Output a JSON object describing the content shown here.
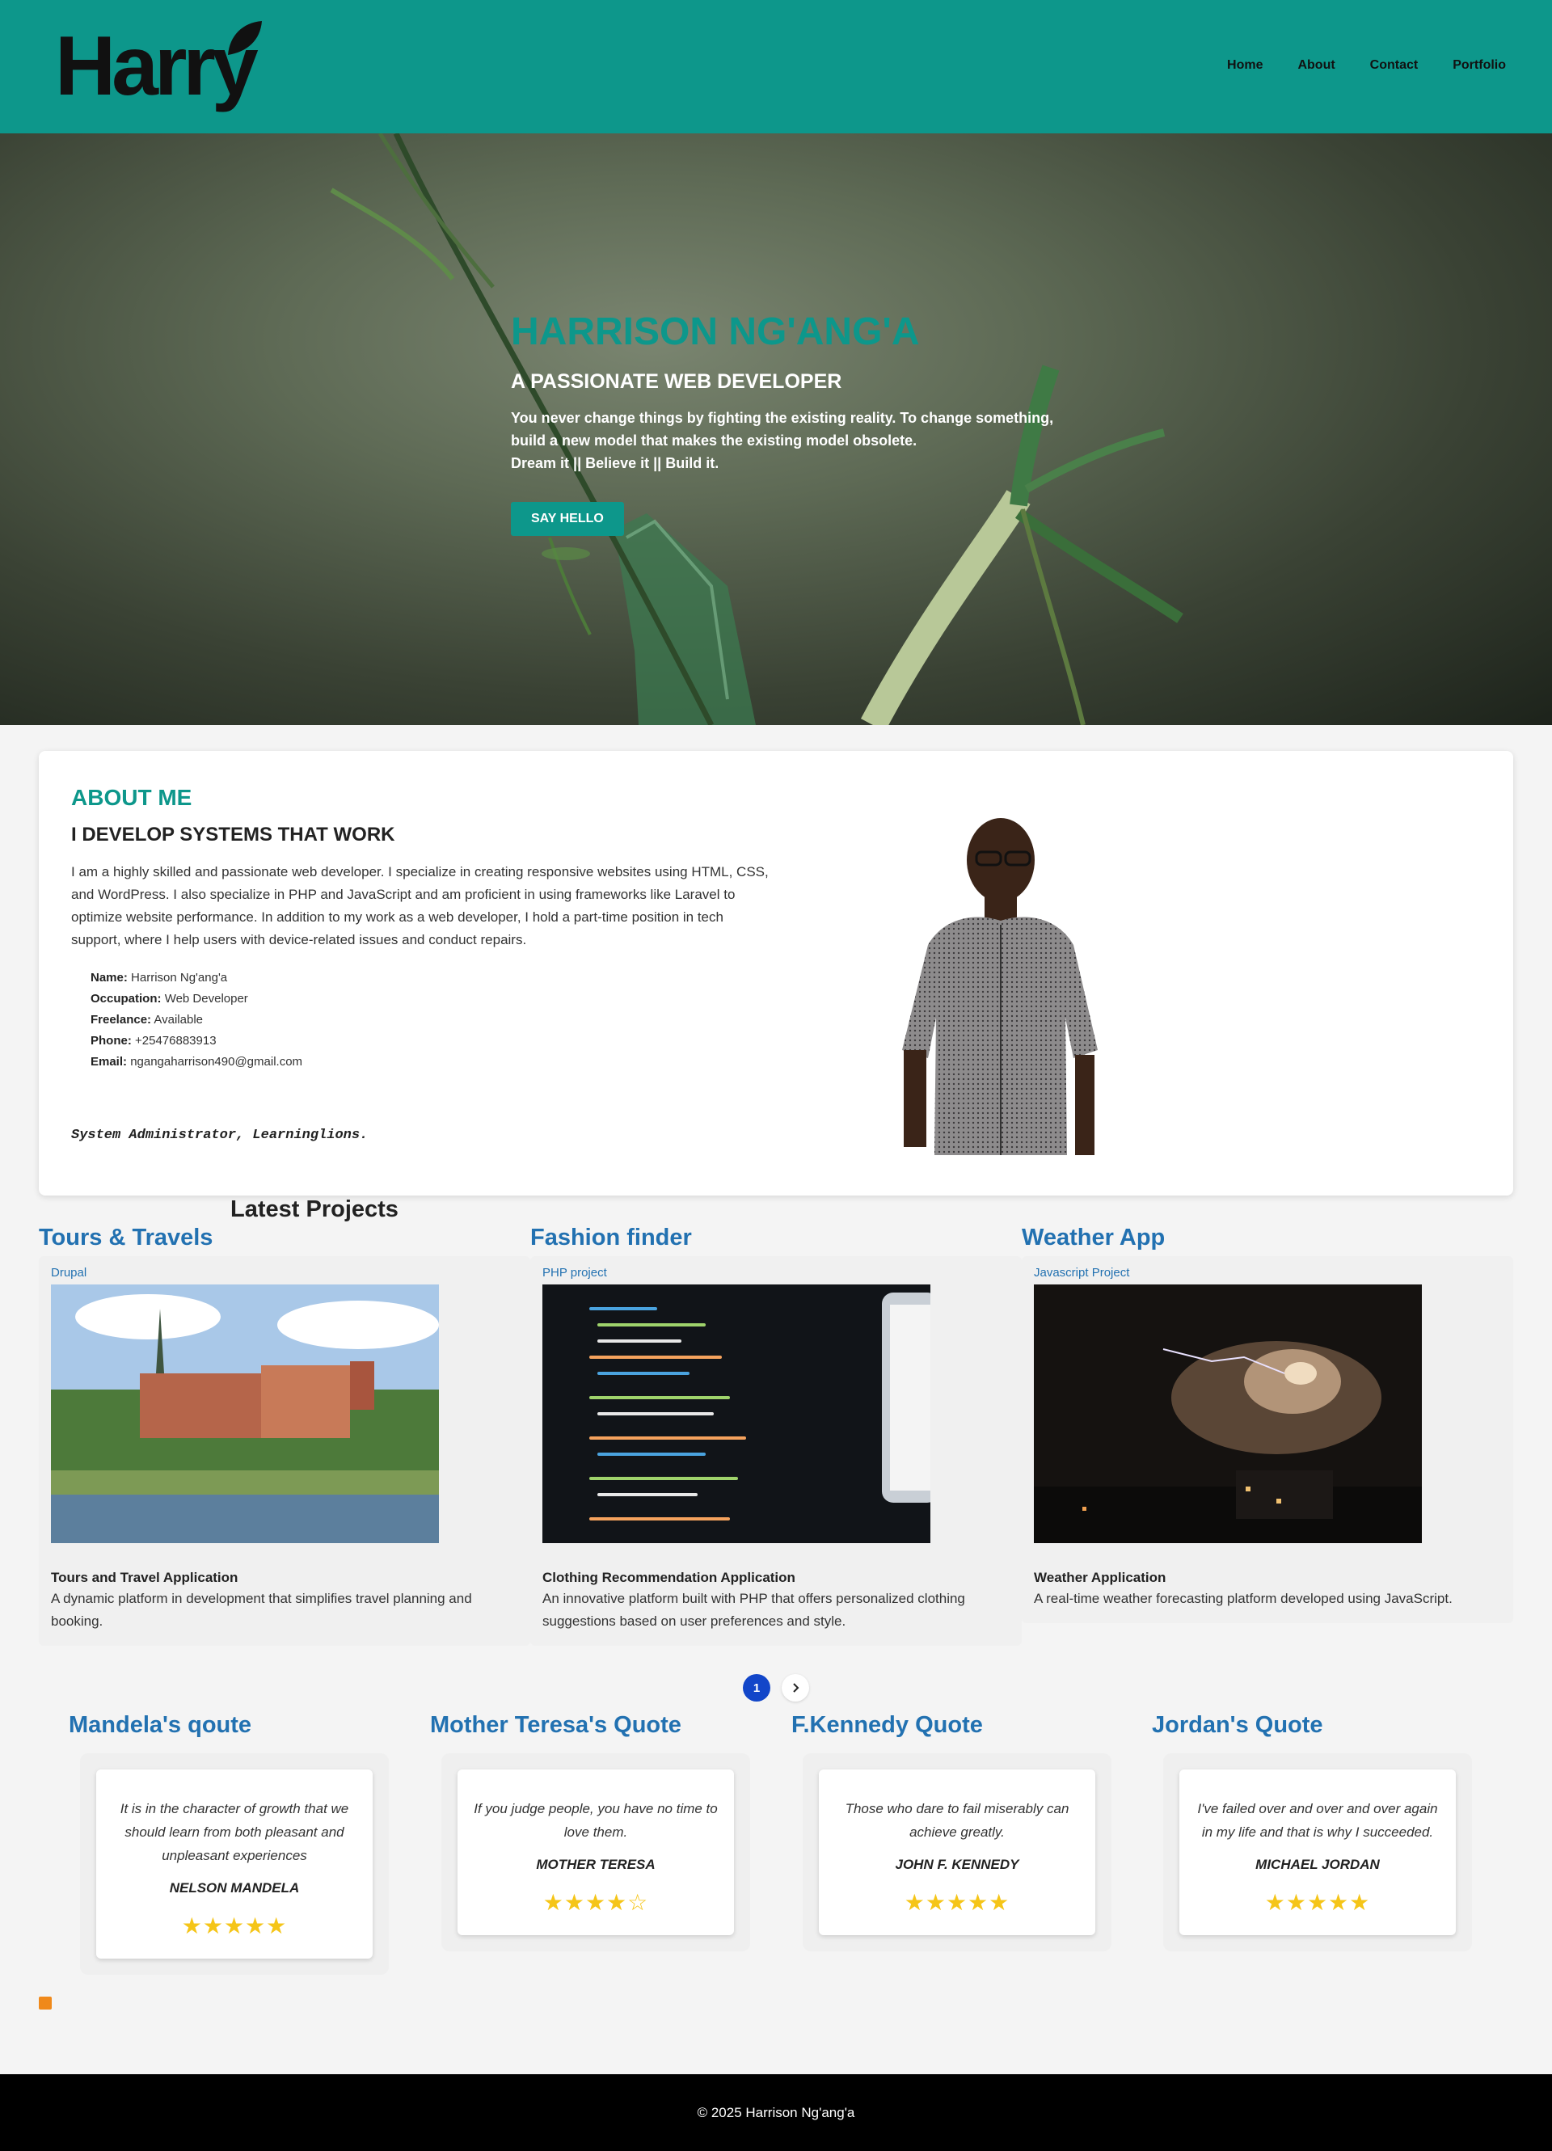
{
  "header": {
    "logo_text": "Harry",
    "nav": [
      "Home",
      "About",
      "Contact",
      "Portfolio"
    ]
  },
  "hero": {
    "name": "HARRISON NG'ANG'A",
    "role": "A PASSIONATE WEB DEVELOPER",
    "quote_line1": "You never change things by fighting the existing reality. To change something,",
    "quote_line2": "build a new model that makes the existing model obsolete.",
    "quote_line3": "Dream it || Believe it || Build it.",
    "button": "SAY HELLO"
  },
  "about": {
    "title": "ABOUT ME",
    "subtitle": "I DEVELOP SYSTEMS THAT WORK",
    "body": "I am a highly skilled and passionate web developer. I specialize in creating responsive websites using HTML, CSS, and WordPress. I also specialize in PHP and JavaScript and am proficient in using frameworks like Laravel to optimize website performance. In addition to my work as a web developer, I hold a part-time position in tech support, where I help users with device-related issues and conduct repairs.",
    "details": [
      {
        "label": "Name:",
        "value": "Harrison Ng'ang'a"
      },
      {
        "label": "Occupation:",
        "value": "Web Developer"
      },
      {
        "label": "Freelance:",
        "value": "Available"
      },
      {
        "label": "Phone:",
        "value": "+25476883913"
      },
      {
        "label": "Email:",
        "value": "ngangaharrison490@gmail.com"
      }
    ],
    "footer_line": "System Administrator, Learninglions."
  },
  "projects": {
    "title": "Latest Projects",
    "items": [
      {
        "name": "Tours & Travels",
        "category": "Drupal",
        "heading": "Tours and Travel Application",
        "description": "A dynamic platform in development that simplifies travel planning and booking."
      },
      {
        "name": "Fashion finder",
        "category": "PHP project",
        "heading": "Clothing Recommendation Application",
        "description": "An innovative platform built with PHP that offers personalized clothing suggestions based on user preferences and style."
      },
      {
        "name": "Weather App",
        "category": "Javascript Project",
        "heading": "Weather Application",
        "description": "A real-time weather forecasting platform developed using JavaScript."
      }
    ]
  },
  "pagination": {
    "current": "1",
    "next_icon": "chevron-right-icon"
  },
  "quotes": [
    {
      "title": "Mandela's qoute",
      "text": "It is in the character of growth that we should learn from both pleasant and unpleasant experiences",
      "author": "NELSON MANDELA",
      "rating": 5
    },
    {
      "title": "Mother Teresa's Quote",
      "text": "If you judge people, you have no time to love them.",
      "author": "MOTHER TERESA",
      "rating": 4
    },
    {
      "title": "F.Kennedy Quote",
      "text": "Those who dare to fail miserably can achieve greatly.",
      "author": "JOHN F. KENNEDY",
      "rating": 5
    },
    {
      "title": "Jordan's Quote",
      "text": "I've failed over and over and over again in my life and that is why I succeeded.",
      "author": "MICHAEL JORDAN",
      "rating": 5
    }
  ],
  "footer": {
    "copyright": "© 2025 Harrison Ng'ang'a"
  },
  "colors": {
    "brand": "#0d978b",
    "link": "#2271b1",
    "pager_active": "#1246c9",
    "star": "#f5c518"
  }
}
